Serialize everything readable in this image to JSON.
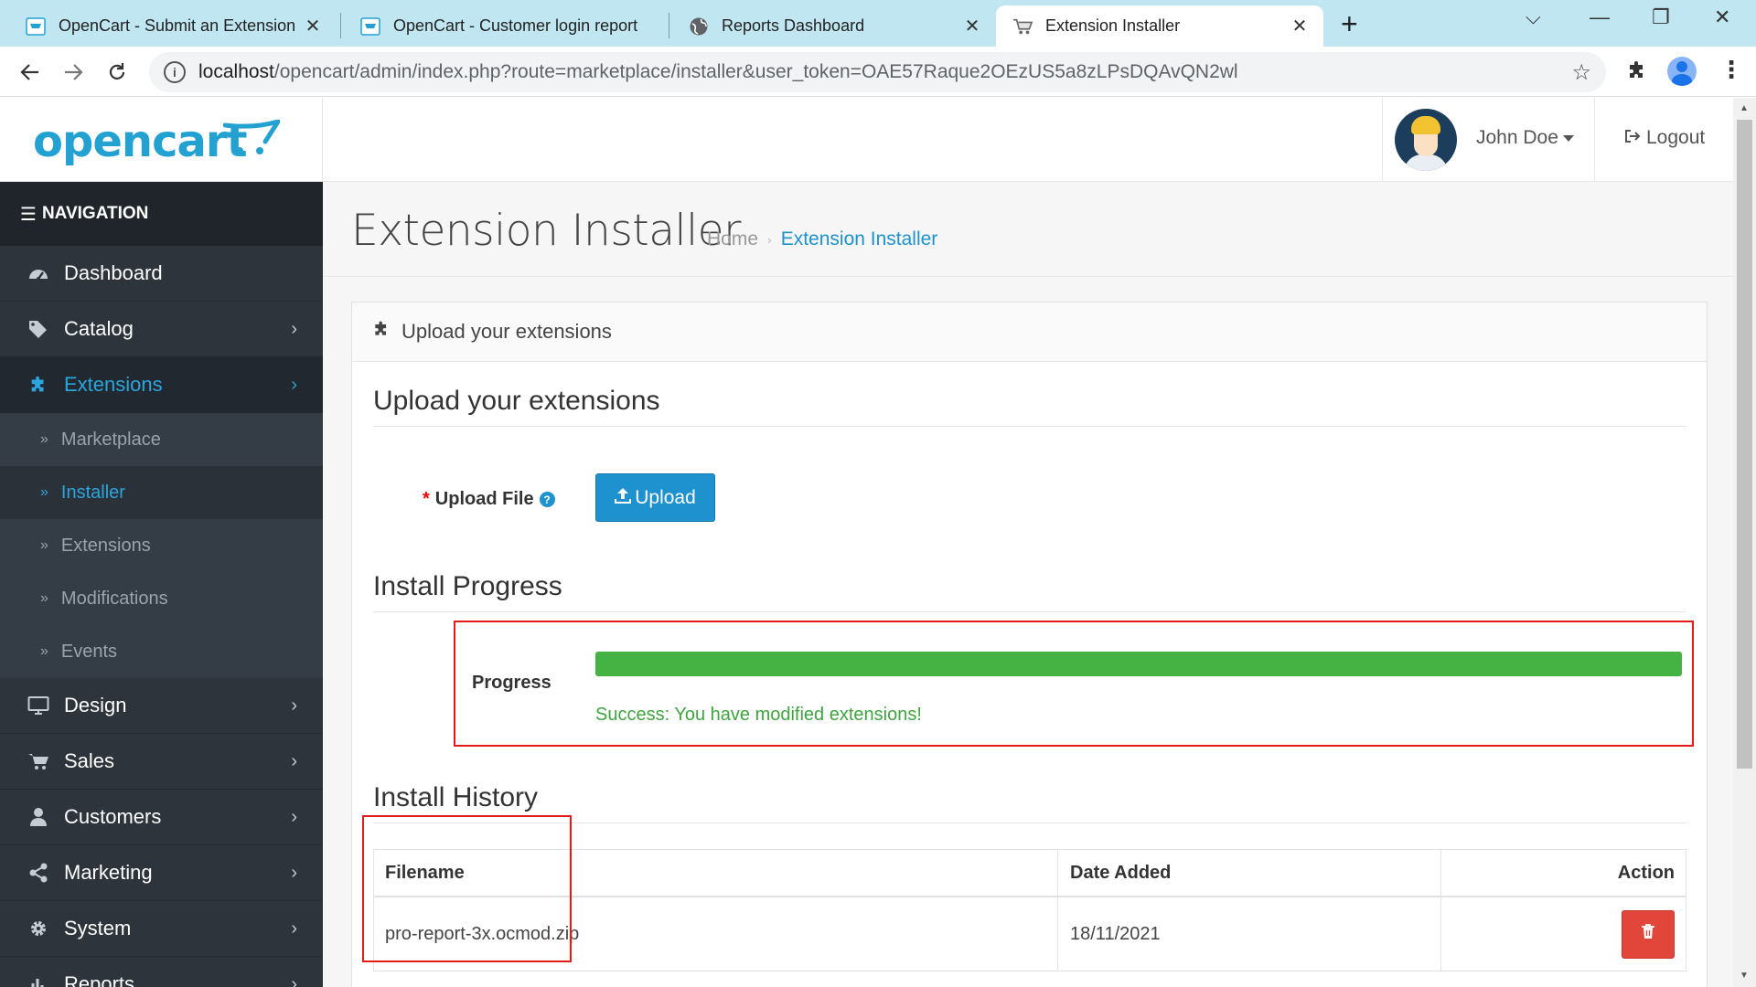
{
  "browser": {
    "tabs": [
      {
        "title": "OpenCart - Submit an Extension",
        "icon": "opencart-favicon"
      },
      {
        "title": "OpenCart - Customer login report",
        "icon": "opencart-favicon"
      },
      {
        "title": "Reports Dashboard",
        "icon": "globe-icon"
      },
      {
        "title": "Extension Installer",
        "icon": "cart-favicon",
        "active": true
      }
    ],
    "url_host": "localhost",
    "url_path": "/opencart/admin/index.php?route=marketplace/installer&user_token=OAE57Raque2OEzUS5a8zLPsDQAvQN2wl"
  },
  "header": {
    "logo": "opencart",
    "user_name": "John Doe",
    "logout_label": "Logout"
  },
  "sidebar": {
    "heading": "NAVIGATION",
    "items": [
      {
        "label": "Dashboard"
      },
      {
        "label": "Catalog"
      },
      {
        "label": "Extensions"
      },
      {
        "label": "Marketplace"
      },
      {
        "label": "Installer"
      },
      {
        "label": "Extensions"
      },
      {
        "label": "Modifications"
      },
      {
        "label": "Events"
      },
      {
        "label": "Design"
      },
      {
        "label": "Sales"
      },
      {
        "label": "Customers"
      },
      {
        "label": "Marketing"
      },
      {
        "label": "System"
      },
      {
        "label": "Reports"
      }
    ]
  },
  "page": {
    "title": "Extension Installer",
    "breadcrumb": [
      "Home",
      "Extension Installer"
    ],
    "panel_title": "Upload your extensions",
    "upload_legend": "Upload your extensions",
    "upload_label": "Upload File",
    "required_mark": "*",
    "upload_button": "Upload",
    "progress_legend": "Install Progress",
    "progress_label": "Progress",
    "progress_percent": 100,
    "success_message": "Success: You have modified extensions!",
    "history_legend": "Install History",
    "table": {
      "headers": [
        "Filename",
        "Date Added",
        "Action"
      ],
      "rows": [
        {
          "filename": "pro-report-3x.ocmod.zip",
          "date_added": "18/11/2021"
        }
      ]
    }
  },
  "colors": {
    "brand": "#23a1d1",
    "primary": "#1e91cf",
    "success": "#44b344",
    "danger": "#e2463a",
    "highlight": "#e21a1a"
  }
}
